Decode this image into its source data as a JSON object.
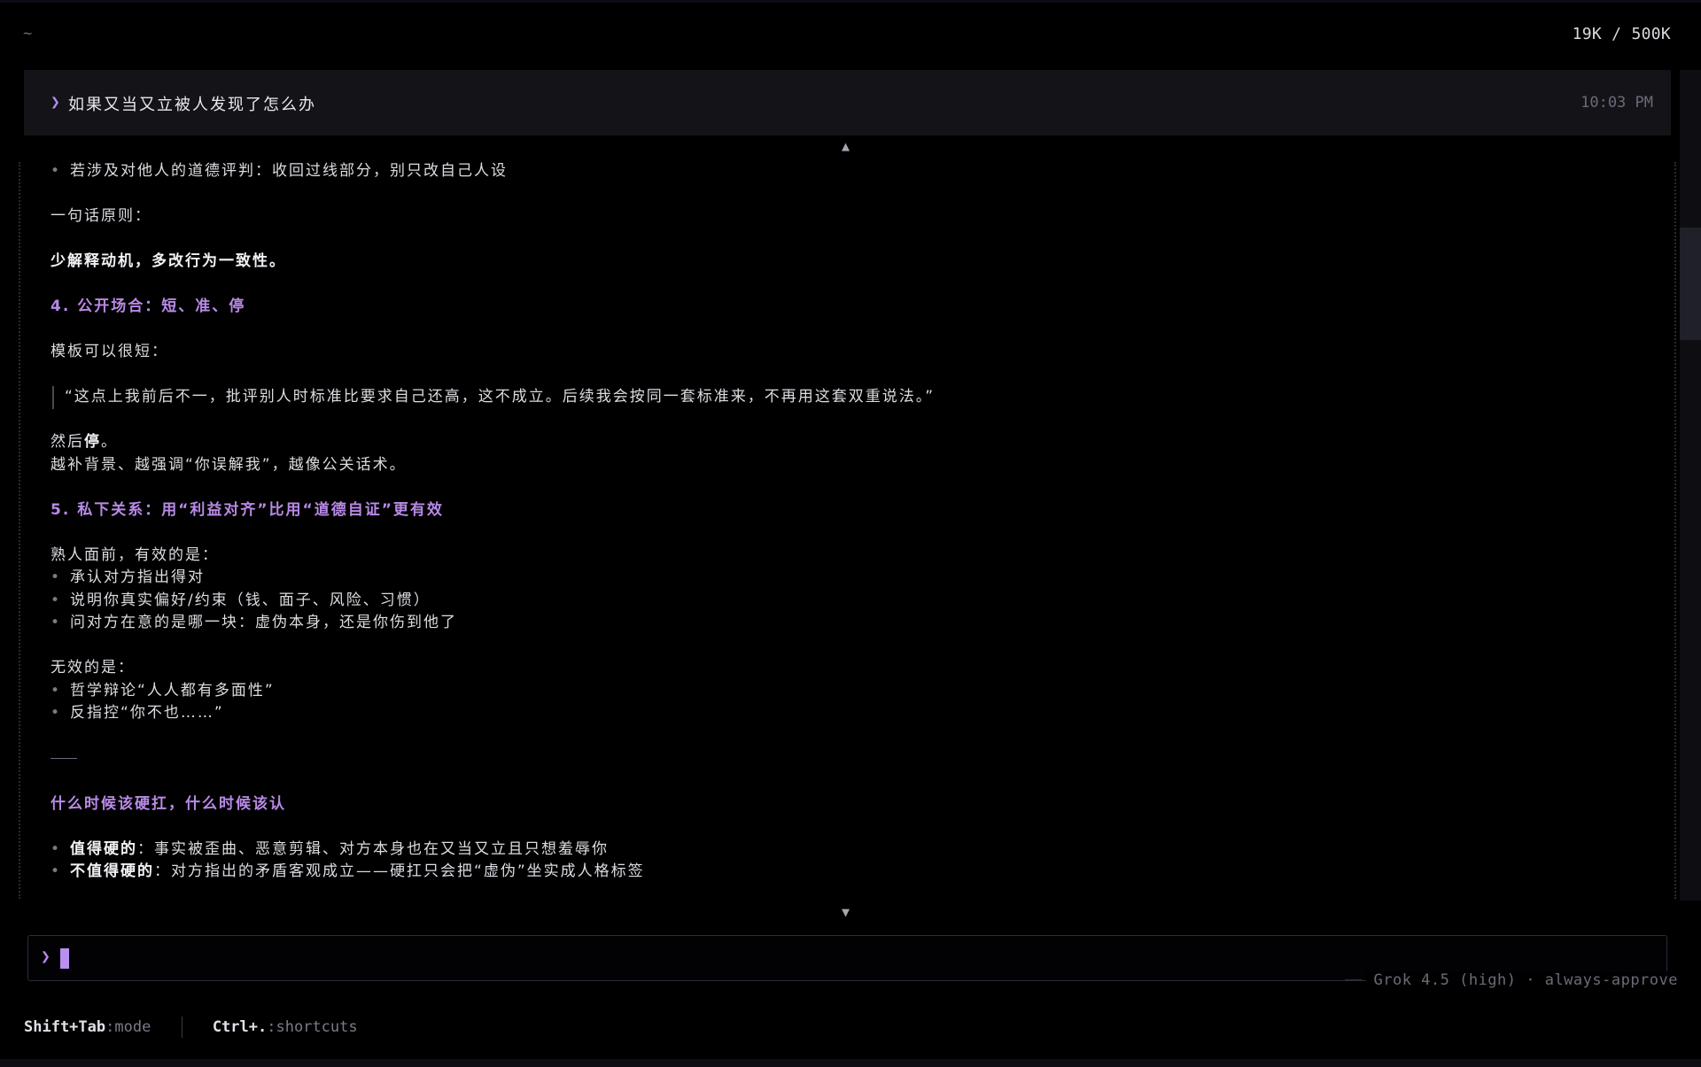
{
  "header": {
    "cwd": "~",
    "token_usage": "19K / 500K"
  },
  "user_message": {
    "prompt_symbol": "❯",
    "text": "如果又当又立被人发现了怎么办",
    "time": "10:03 PM"
  },
  "scroll": {
    "up_arrow": "▲",
    "down_arrow": "▼"
  },
  "response": {
    "line1_bullet": "•",
    "line1": "若涉及对他人的道德评判：收回过线部分，别只改自己人设",
    "principle_intro": "一句话原则：",
    "principle": "少解释动机，多改行为一致性。",
    "section4_heading": "4. 公开场合：短、准、停",
    "template_intro": "模板可以很短：",
    "template_quote": "“这点上我前后不一，批评别人时标准比要求自己还高，这不成立。后续我会按同一套标准来，不再用这套双重说法。”",
    "then_prefix": "然后",
    "then_bold": "停",
    "then_suffix": "。",
    "more_line": "越补背景、越强调“你误解我”，越像公关话术。",
    "section5_heading": "5. 私下关系：用“利益对齐”比用“道德自证”更有效",
    "effective_intro": "熟人面前，有效的是：",
    "effective_items": [
      "承认对方指出得对",
      "说明你真实偏好/约束（钱、面子、风险、习惯）",
      "问对方在意的是哪一块：虚伪本身，还是你伤到他了"
    ],
    "ineffective_intro": "无效的是：",
    "ineffective_items": [
      "哲学辩论“人人都有多面性”",
      "反指控“你不也……”"
    ],
    "final_heading": "什么时候该硬扛，什么时候该认",
    "worth_label": "值得硬的",
    "worth_text": "：事实被歪曲、恶意剪辑、对方本身也在又当又立且只想羞辱你",
    "not_worth_label": "不值得硬的",
    "not_worth_text": "：对方指出的矛盾客观成立——硬扛只会把“虚伪”坐实成人格标签"
  },
  "input": {
    "prompt_symbol": "❯",
    "value": "",
    "model_status": "Grok 4.5 (high) · always-approve"
  },
  "footer": {
    "mode_key": "Shift+Tab",
    "mode_label": ":mode",
    "shortcuts_key": "Ctrl+.",
    "shortcuts_label": ":shortcuts"
  },
  "colors": {
    "accent": "#b88ae6",
    "background": "#000000",
    "panel": "#131318"
  }
}
